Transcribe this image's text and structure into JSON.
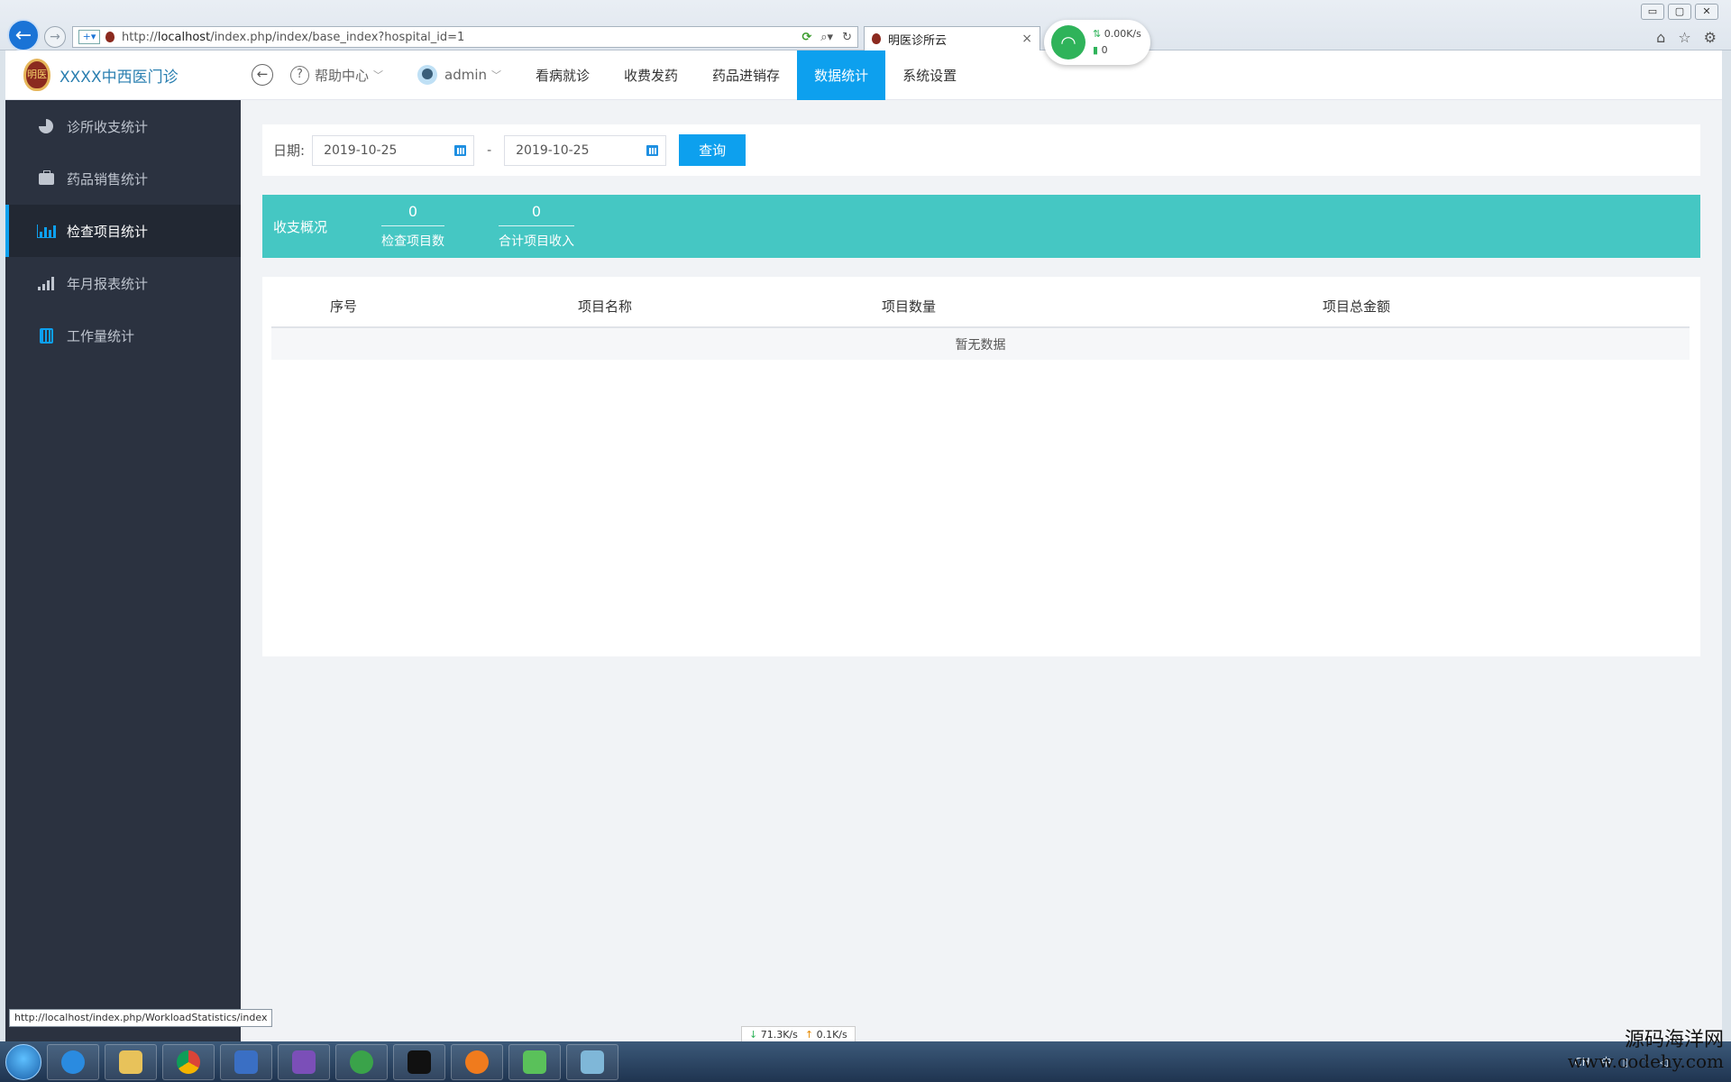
{
  "browser": {
    "url_prefix": "http://",
    "url_host": "localhost",
    "url_path": "/index.php/index/base_index?hospital_id=1",
    "tab_title": "明医诊所云",
    "tab_close": "×",
    "window_controls": [
      "▭",
      "▢",
      "✕"
    ],
    "network_widget": {
      "speed": "0.00K/s",
      "count": "0"
    },
    "status_url": "http://localhost/index.php/WorkloadStatistics/index",
    "download_speed": "71.3K/s",
    "upload_speed": "0.1K/s"
  },
  "header": {
    "brand_name": "XXXX中西医门诊",
    "logo_text": "明医",
    "back_symbol": "←",
    "help_label": "帮助中心",
    "user_label": "admin",
    "nav": [
      {
        "label": "看病就诊"
      },
      {
        "label": "收费发药"
      },
      {
        "label": "药品进销存"
      },
      {
        "label": "数据统计",
        "active": true
      },
      {
        "label": "系统设置"
      }
    ]
  },
  "sidebar": {
    "items": [
      {
        "label": "诊所收支统计",
        "icon": "pie-chart-icon"
      },
      {
        "label": "药品销售统计",
        "icon": "briefcase-icon"
      },
      {
        "label": "检查项目统计",
        "icon": "bar-chart-icon",
        "active": true
      },
      {
        "label": "年月报表统计",
        "icon": "signal-bars-icon"
      },
      {
        "label": "工作量统计",
        "icon": "calculator-icon"
      }
    ]
  },
  "filter": {
    "date_label": "日期:",
    "start_date": "2019-10-25",
    "separator": "-",
    "end_date": "2019-10-25",
    "query_button": "查询"
  },
  "summary": {
    "title": "收支概况",
    "stats": [
      {
        "value": "0",
        "caption": "检查项目数"
      },
      {
        "value": "0",
        "caption": "合计项目收入"
      }
    ]
  },
  "table": {
    "columns": [
      "序号",
      "项目名称",
      "项目数量",
      "项目总金额"
    ],
    "empty_text": "暂无数据"
  },
  "taskbar": {
    "tray_lang": "CH",
    "tray_ime": "中"
  },
  "watermark": {
    "line1": "源码海洋网",
    "line2": "www.codehy.com"
  },
  "colors": {
    "accent": "#0da0ee",
    "summary_bg": "#45c7c3",
    "sidebar_bg": "#2b3240"
  }
}
